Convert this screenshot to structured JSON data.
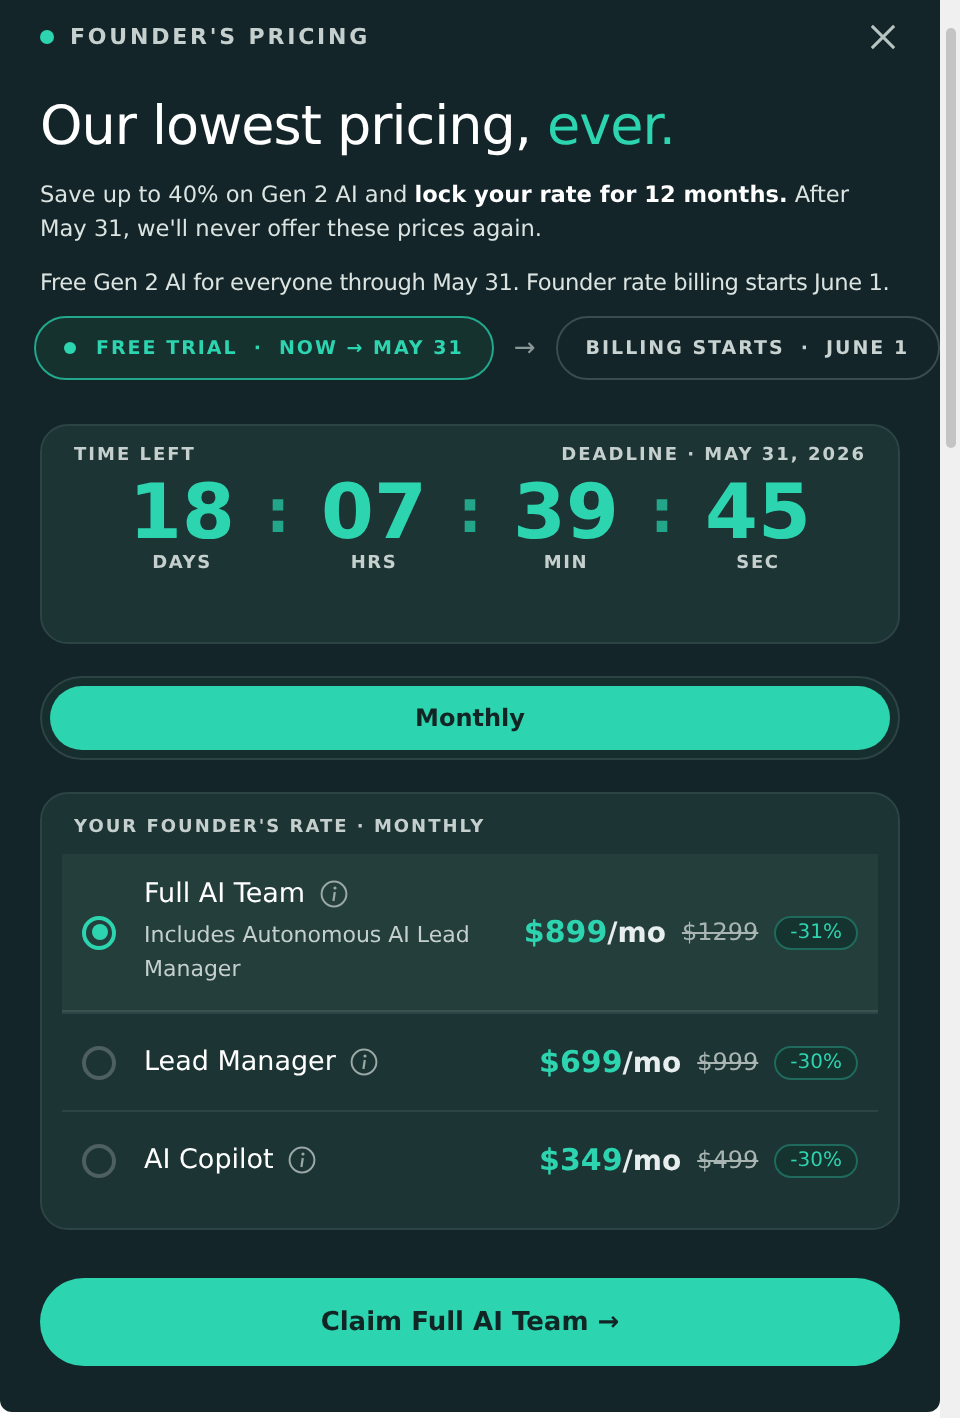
{
  "header": {
    "eyebrow": "FOUNDER'S PRICING"
  },
  "title": {
    "main": "Our lowest pricing,",
    "accent": "ever."
  },
  "intro": "Save up to 40% on Gen 2 AI and **lock your rate for 12 months.** After May 31, we'll never offer these prices again.",
  "note": "Free Gen 2 AI for everyone through May 31. Founder rate billing starts June 1.",
  "timeline": [
    {
      "label": "FREE TRIAL",
      "sep": "·",
      "detail": "NOW → MAY 31",
      "selected": true
    },
    {
      "label": "BILLING STARTS",
      "sep": "·",
      "detail": "JUNE 1",
      "selected": false
    }
  ],
  "timeline_arrow": "→",
  "countdown": {
    "label": "TIME LEFT",
    "deadline": "DEADLINE · MAY 31, 2026",
    "separator": ":",
    "units": [
      {
        "value": "18",
        "unit": "DAYS"
      },
      {
        "value": "07",
        "unit": "HRS"
      },
      {
        "value": "39",
        "unit": "MIN"
      },
      {
        "value": "45",
        "unit": "SEC"
      }
    ]
  },
  "billing_tabs": [
    {
      "label": "Monthly",
      "selected": true
    }
  ],
  "plans": {
    "heading": "YOUR FOUNDER'S RATE · MONTHLY",
    "items": [
      {
        "name": "Full AI Team",
        "description": "Includes Autonomous AI Lead Manager",
        "price": "$899",
        "period": "/mo",
        "old_price": "$1299",
        "discount": "-31%",
        "selected": true
      },
      {
        "name": "Lead Manager",
        "price": "$699",
        "period": "/mo",
        "old_price": "$999",
        "discount": "-30%",
        "selected": false
      },
      {
        "name": "AI Copilot",
        "price": "$349",
        "period": "/mo",
        "old_price": "$499",
        "discount": "-30%",
        "selected": false
      }
    ]
  },
  "cta": {
    "label": "Claim Full AI Team",
    "arrow": "→"
  }
}
